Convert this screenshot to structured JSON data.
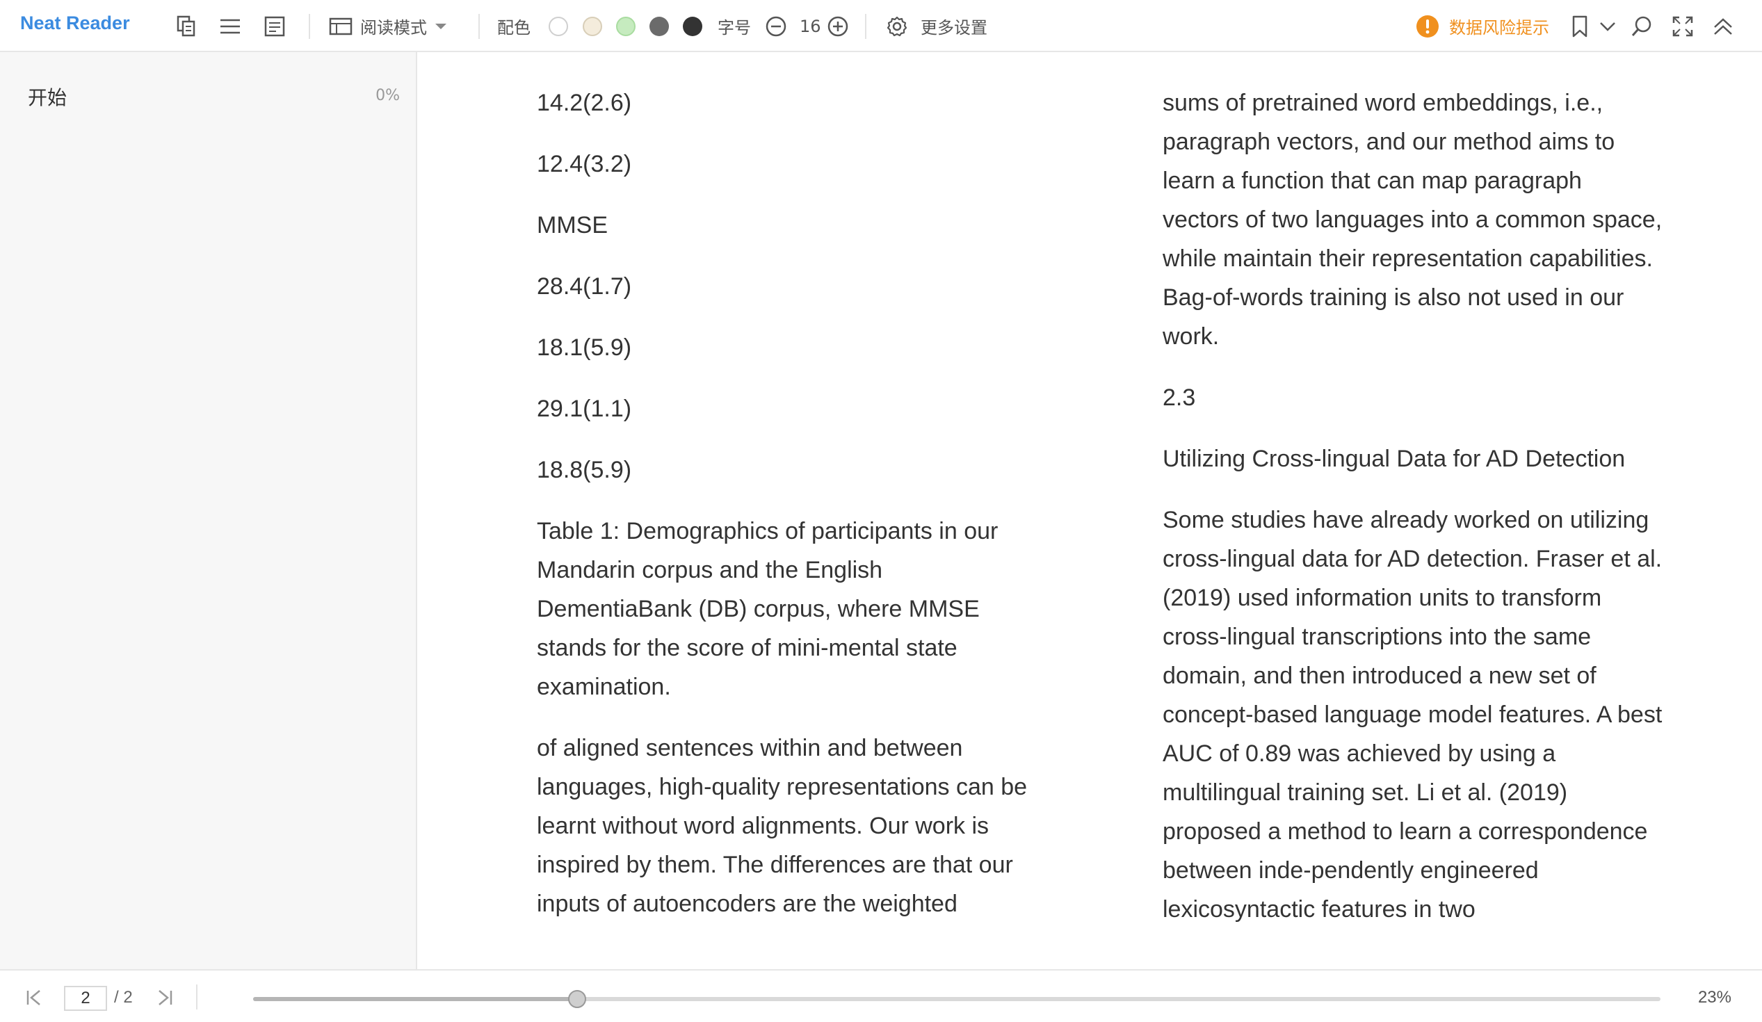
{
  "app": {
    "title": "Neat Reader"
  },
  "toolbar": {
    "reading_mode_label": "阅读模式",
    "color_label": "配色",
    "font_size_label": "字号",
    "font_size_value": "16",
    "more_settings_label": "更多设置",
    "risk_label": "数据风险提示",
    "swatches": [
      "#ffffff",
      "#f4ecdc",
      "#c6ebbf",
      "#6b6b6b",
      "#333333"
    ]
  },
  "sidebar": {
    "items": [
      {
        "label": "开始",
        "percent": "0%"
      }
    ]
  },
  "content": {
    "left_paragraphs": [
      "14.2(2.6)",
      "12.4(3.2)",
      "MMSE",
      "28.4(1.7)",
      "18.1(5.9)",
      "29.1(1.1)",
      "18.8(5.9)",
      "Table 1: Demographics of participants in our Mandarin corpus and the English DementiaBank (DB) corpus, where MMSE stands for the score of mini-mental state examination.",
      "of aligned sentences within and between languages, high-quality representations can be learnt without word alignments. Our work is inspired by them. The differences are that our inputs of autoencoders are the weighted"
    ],
    "right_paragraphs": [
      "sums of pretrained word embeddings, i.e., paragraph vectors, and our method aims to learn a function that can map paragraph vectors of two languages into a common space, while maintain their representation capabilities. Bag-of-words training is also not used in our work.",
      "2.3",
      "Utilizing Cross-lingual Data for AD Detection",
      "Some studies have already worked on utilizing cross-lingual data for AD detection. Fraser et al. (2019) used information units to transform cross-lingual transcriptions into the same domain, and then introduced a new set of concept-based language model features. A best AUC of 0.89 was achieved by using a multilingual training set. Li et al. (2019) proposed a method to learn a correspondence between inde-pendently engineered lexicosyntactic features in two"
    ]
  },
  "footer": {
    "current_page": "2",
    "total_pages": "/ 2",
    "progress_fraction": 0.23,
    "progress_percent": "23%"
  }
}
